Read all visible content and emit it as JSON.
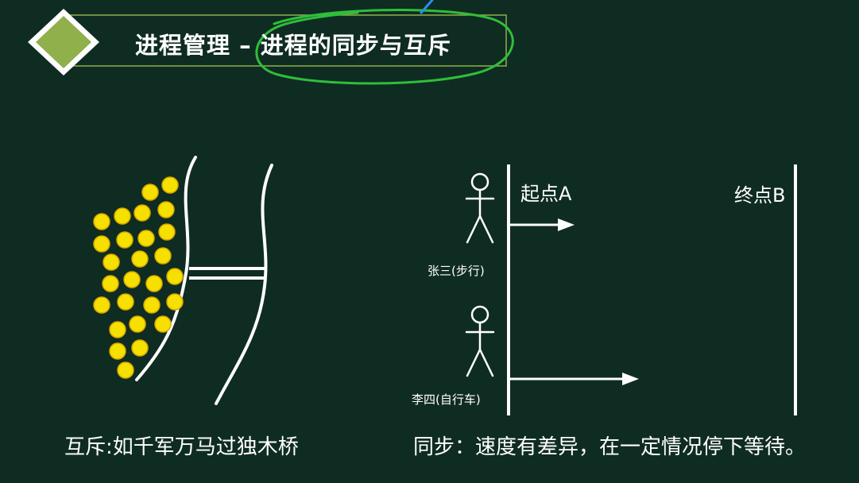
{
  "header": {
    "title": "进程管理 – 进程的同步与互斥"
  },
  "colors": {
    "background": "#0f2c22",
    "accent_green": "#8fb04a",
    "highlight_circle": "#2fbe3a",
    "coin_yellow": "#f5e000",
    "line_white": "#ffffff",
    "pen_blue": "#2a8ff0"
  },
  "mutex_diagram": {
    "caption": "互斥:如千军万马过独木桥"
  },
  "sync_diagram": {
    "start_label": "起点A",
    "end_label": "终点B",
    "walker_label": "张三(步行)",
    "cyclist_label": "李四(自行车)",
    "caption": "同步：速度有差异，在一定情况停下等待。"
  }
}
